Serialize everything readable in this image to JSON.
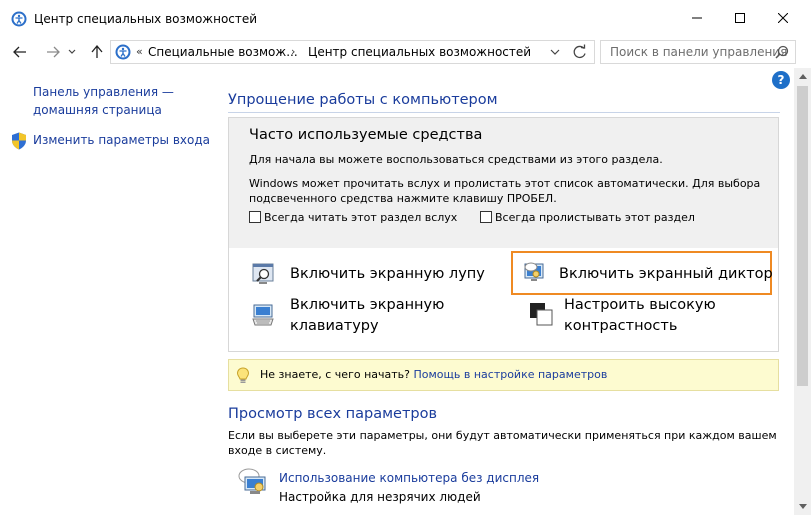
{
  "window": {
    "title": "Центр специальных возможностей"
  },
  "address": {
    "overflow": "«",
    "crumb1": "Специальные возмож...",
    "separator": "›",
    "crumb2": "Центр специальных возможностей"
  },
  "search": {
    "placeholder": "Поиск в панели управления"
  },
  "help": {
    "label": "?"
  },
  "sidebar": {
    "home": "Панель управления — домашняя страница",
    "signin": "Изменить параметры входа"
  },
  "section1": {
    "title": "Упрощение работы с компьютером",
    "panel_title": "Часто используемые средства",
    "desc1": "Для начала вы можете воспользоваться средствами из этого раздела.",
    "desc2": "Windows может прочитать вслух и пролистать этот список автоматически. Для выбора подсвеченного средства нажмите клавишу ПРОБЕЛ.",
    "checkbox_read": "Всегда читать этот раздел вслух",
    "checkbox_scan": "Всегда пролистывать этот раздел",
    "tools": {
      "magnifier": "Включить экранную лупу",
      "narrator": "Включить экранный диктор",
      "keyboard": "Включить экранную клавиатуру",
      "contrast": "Настроить высокую контрастность"
    }
  },
  "tip": {
    "text": "Не знаете, с чего начать?",
    "link": "Помощь в настройке параметров"
  },
  "section2": {
    "title": "Просмотр всех параметров",
    "desc": "Если вы выберете эти параметры, они будут автоматически применяться при каждом вашем входе в систему.",
    "item_link": "Использование компьютера без дисплея",
    "item_sub": "Настройка для незрячих людей"
  },
  "colors": {
    "link": "#1a3c9c",
    "highlight": "#ef8a23",
    "tip_bg": "#fdfbd0"
  },
  "checkboxes": {
    "read_aloud": false,
    "auto_scan": false
  }
}
